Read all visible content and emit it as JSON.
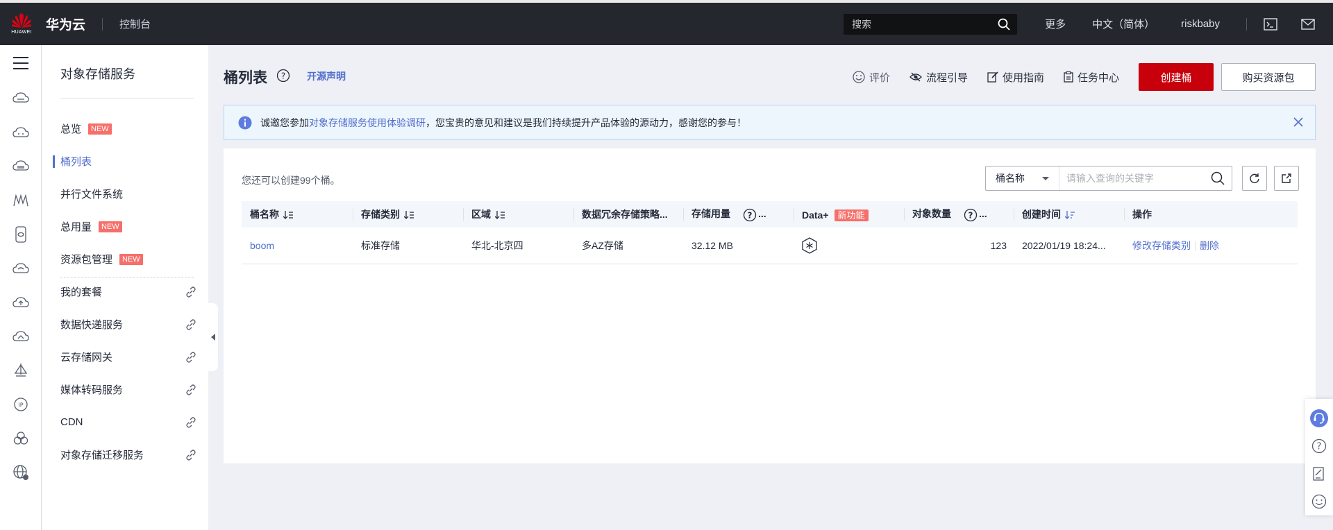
{
  "topbar": {
    "logo_text": "HUAWEI",
    "brand": "华为云",
    "console": "控制台",
    "search_placeholder": "搜索",
    "more": "更多",
    "language": "中文（简体）",
    "username": "riskbaby"
  },
  "rail_icons": [
    "menu-icon",
    "cloud-server-icon",
    "cloud-icon",
    "storage-icon",
    "network-icon",
    "database-icon",
    "cloud-storage-icon",
    "cloud-upload-icon",
    "cloud-sync-icon",
    "sailboat-icon",
    "ip-icon",
    "cluster-icon",
    "globe-icon"
  ],
  "subnav": {
    "title": "对象存储服务",
    "new_badge": "NEW",
    "items": [
      {
        "label": "总览"
      },
      {
        "label": "桶列表"
      },
      {
        "label": "并行文件系统"
      },
      {
        "label": "总用量"
      },
      {
        "label": "资源包管理"
      },
      {
        "label": "我的套餐"
      },
      {
        "label": "数据快递服务"
      },
      {
        "label": "云存储网关"
      },
      {
        "label": "媒体转码服务"
      },
      {
        "label": "CDN"
      },
      {
        "label": "对象存储迁移服务"
      }
    ]
  },
  "header": {
    "title": "桶列表",
    "open_source": "开源声明",
    "rate": "评价",
    "flow_guide": "流程引导",
    "user_guide": "使用指南",
    "task_center": "任务中心",
    "create_bucket": "创建桶",
    "buy_package": "购买资源包"
  },
  "notice": {
    "prefix": "诚邀您参加",
    "link": "对象存储服务使用体验调研",
    "suffix": "，您宝贵的意见和建议是我们持续提升产品体验的源动力，感谢您的参与！"
  },
  "table_area": {
    "remaining": "您还可以创建99个桶。",
    "filter_field": "桶名称",
    "filter_placeholder": "请输入查询的关键字",
    "new_feature_tag": "新功能",
    "columns": [
      "桶名称",
      "存储类别",
      "区域",
      "数据冗余存储策略...",
      "存储用量",
      "Data+",
      "对象数量",
      "创建时间",
      "操作"
    ],
    "rows": [
      {
        "name": "boom",
        "storage_class": "标准存储",
        "region": "华北-北京四",
        "redundancy": "多AZ存储",
        "usage": "32.12 MB",
        "objects": "123",
        "created": "2022/01/19 18:24...",
        "op_modify": "修改存储类别",
        "op_delete": "删除"
      }
    ]
  },
  "accent_colors": {
    "primary": "#c7000b",
    "link": "#526ecc",
    "badge": "#f66f6a"
  }
}
